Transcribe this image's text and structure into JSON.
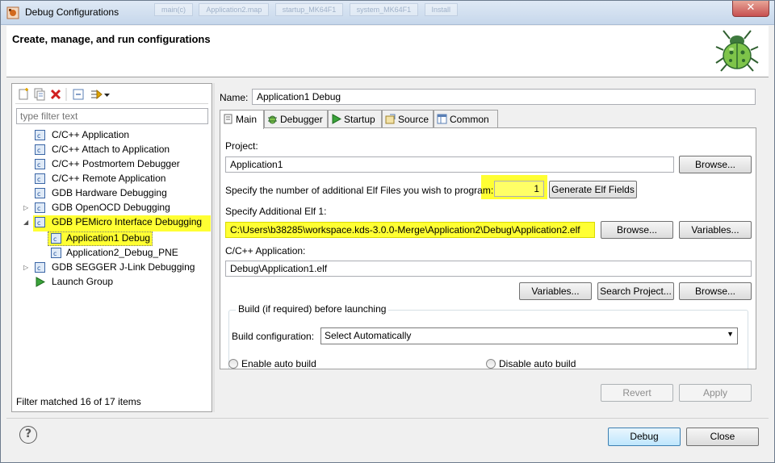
{
  "window": {
    "title": "Debug Configurations",
    "background_tabs": [
      "main(c)",
      "Application2.map",
      "startup_MK64F1",
      "system_MK64F1",
      "Install"
    ]
  },
  "header": {
    "title": "Create, manage, and run configurations",
    "icon": "bug-icon"
  },
  "left": {
    "toolbar_icons": [
      "new-configuration-icon",
      "duplicate-icon",
      "delete-icon",
      "collapse-all-icon",
      "filter-icon",
      "dropdown-arrow-icon"
    ],
    "filter_placeholder": "type filter text",
    "tree": [
      {
        "label": "C/C++ Application"
      },
      {
        "label": "C/C++ Attach to Application"
      },
      {
        "label": "C/C++ Postmortem Debugger"
      },
      {
        "label": "C/C++ Remote Application"
      },
      {
        "label": "GDB Hardware Debugging"
      },
      {
        "label": "GDB OpenOCD Debugging"
      },
      {
        "label": "GDB PEMicro Interface Debugging"
      },
      {
        "label": "Application1 Debug"
      },
      {
        "label": "Application2_Debug_PNE"
      },
      {
        "label": "GDB SEGGER J-Link Debugging"
      },
      {
        "label": "Launch Group"
      }
    ],
    "status": "Filter matched 16 of 17 items"
  },
  "right": {
    "name_label": "Name:",
    "name_value": "Application1 Debug",
    "tabs": [
      {
        "label": "Main",
        "icon": "main-tab-icon"
      },
      {
        "label": "Debugger",
        "icon": "debugger-tab-icon"
      },
      {
        "label": "Startup",
        "icon": "startup-tab-icon"
      },
      {
        "label": "Source",
        "icon": "source-tab-icon"
      },
      {
        "label": "Common",
        "icon": "common-tab-icon"
      }
    ],
    "project_label": "Project:",
    "project_value": "Application1",
    "browse": "Browse...",
    "elf_count_label": "Specify the number of additional Elf Files you wish to program:",
    "elf_count_value": "1",
    "generate_button": "Generate Elf Fields",
    "additional_elf_label": "Specify Additional Elf 1:",
    "additional_elf_value": "C:\\Users\\b38285\\workspace.kds-3.0.0-Merge\\Application2\\Debug\\Application2.elf",
    "variables": "Variables...",
    "cc_app_label": "C/C++ Application:",
    "cc_app_value": "Debug\\Application1.elf",
    "search_project": "Search Project...",
    "build_group_title": "Build (if required) before launching",
    "build_config_label": "Build configuration:",
    "build_config_value": "Select Automatically",
    "enable_auto_build": "Enable auto build",
    "disable_auto_build": "Disable auto build",
    "revert": "Revert",
    "apply": "Apply"
  },
  "footer": {
    "help": "?",
    "debug": "Debug",
    "close": "Close"
  },
  "colors": {
    "highlight": "#ffff33",
    "default_button_border": "#3c7fb1"
  }
}
